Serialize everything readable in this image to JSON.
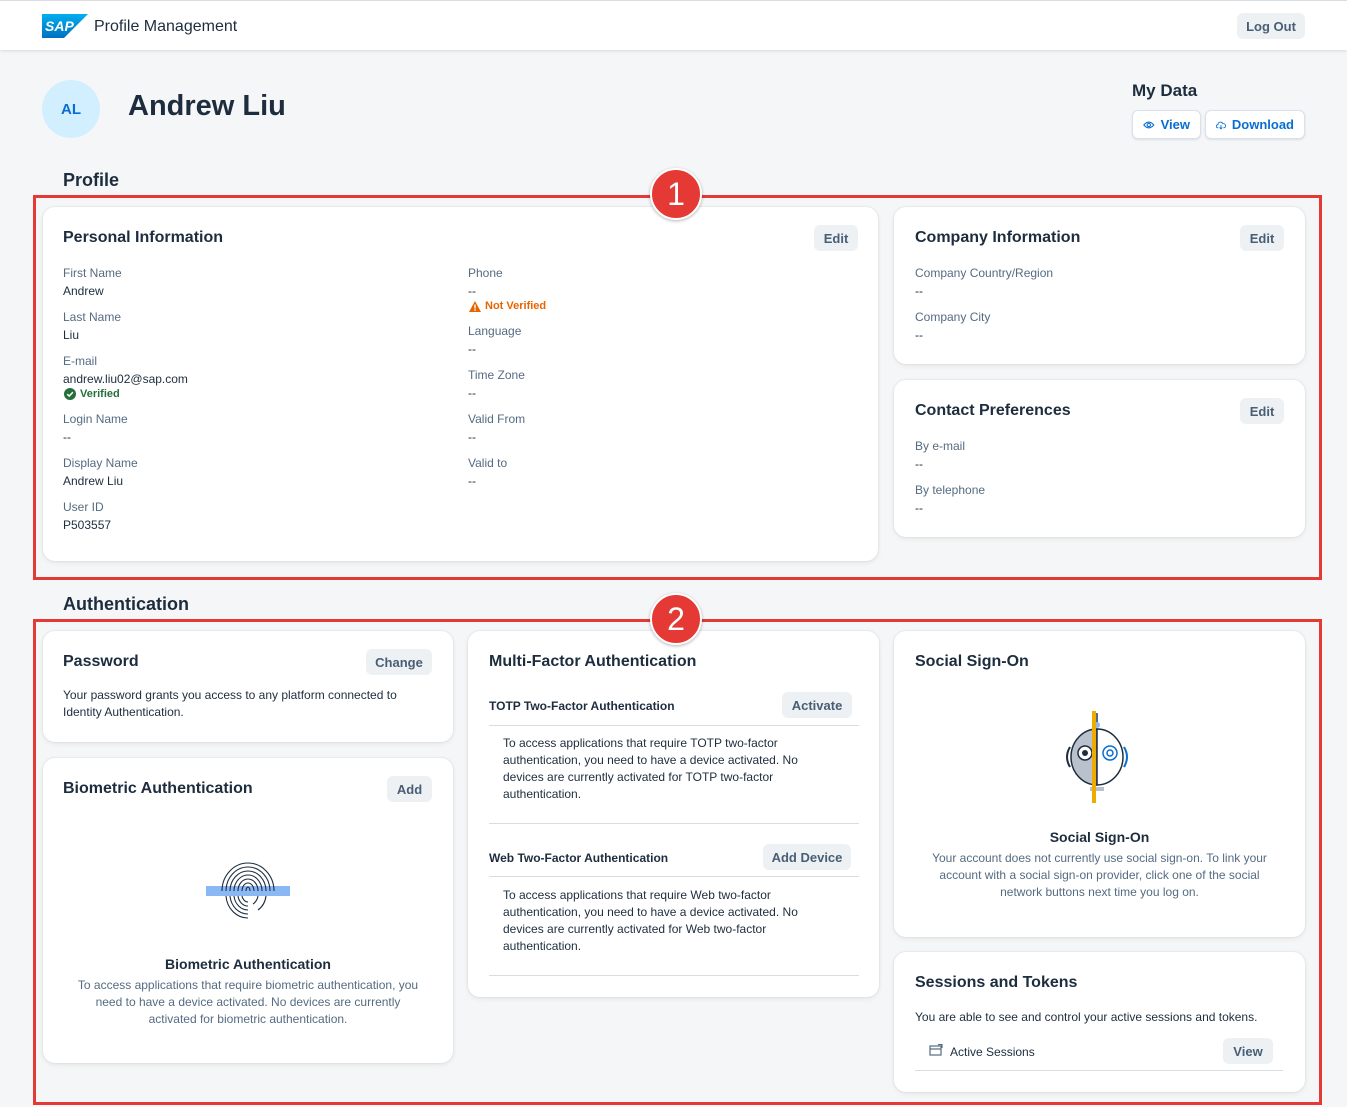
{
  "app": {
    "logo": "SAP",
    "title": "Profile Management",
    "logout_label": "Log Out"
  },
  "user": {
    "initials": "AL",
    "name": "Andrew Liu"
  },
  "my_data": {
    "title": "My Data",
    "view_label": "View",
    "download_label": "Download"
  },
  "profile": {
    "section_title": "Profile",
    "personal": {
      "title": "Personal Information",
      "edit_label": "Edit",
      "first_name_label": "First Name",
      "first_name": "Andrew",
      "last_name_label": "Last Name",
      "last_name": "Liu",
      "email_label": "E-mail",
      "email": "andrew.liu02@sap.com",
      "email_status": "Verified",
      "login_name_label": "Login Name",
      "login_name": "--",
      "display_name_label": "Display Name",
      "display_name": "Andrew Liu",
      "user_id_label": "User ID",
      "user_id": "P503557",
      "phone_label": "Phone",
      "phone": "--",
      "phone_status": "Not Verified",
      "language_label": "Language",
      "language": "--",
      "time_zone_label": "Time Zone",
      "time_zone": "--",
      "valid_from_label": "Valid From",
      "valid_from": "--",
      "valid_to_label": "Valid to",
      "valid_to": "--"
    },
    "company": {
      "title": "Company Information",
      "edit_label": "Edit",
      "country_label": "Company Country/Region",
      "country": "--",
      "city_label": "Company City",
      "city": "--"
    },
    "contact": {
      "title": "Contact Preferences",
      "edit_label": "Edit",
      "email_label": "By e-mail",
      "email": "--",
      "phone_label": "By telephone",
      "phone": "--"
    }
  },
  "authentication": {
    "section_title": "Authentication",
    "password": {
      "title": "Password",
      "change_label": "Change",
      "description": "Your password grants you access to any platform connected to Identity Authentication."
    },
    "biometric": {
      "title": "Biometric Authentication",
      "add_label": "Add",
      "empty_title": "Biometric Authentication",
      "empty_text": "To access applications that require biometric authentication, you need to have a device activated. No devices are currently activated for biometric authentication."
    },
    "mfa": {
      "title": "Multi-Factor Authentication",
      "totp_title": "TOTP Two-Factor Authentication",
      "totp_action": "Activate",
      "totp_text": "To access applications that require TOTP two-factor authentication, you need to have a device activated. No devices are currently activated for TOTP two-factor authentication.",
      "web_title": "Web Two-Factor Authentication",
      "web_action": "Add Device",
      "web_text": "To access applications that require Web two-factor authentication, you need to have a device activated. No devices are currently activated for Web two-factor authentication."
    },
    "social": {
      "title": "Social Sign-On",
      "empty_title": "Social Sign-On",
      "empty_text": "Your account does not currently use social sign-on. To link your account with a social sign-on provider, click one of the social network buttons next time you log on."
    },
    "sessions": {
      "title": "Sessions and Tokens",
      "description": "You are able to see and control your active sessions and tokens.",
      "active_sessions_label": "Active Sessions",
      "view_label": "View"
    }
  },
  "annotations": {
    "marker_1": "1",
    "marker_2": "2"
  },
  "icons": [
    "sap-logo",
    "eye-icon",
    "cloud-download-icon",
    "check-circle-icon",
    "warning-icon",
    "fingerprint-illustration",
    "robot-illustration",
    "session-icon"
  ],
  "colors": {
    "accent": "#0a6ed1",
    "highlight": "#e53935",
    "success": "#256f3a",
    "warning": "#e76500"
  }
}
